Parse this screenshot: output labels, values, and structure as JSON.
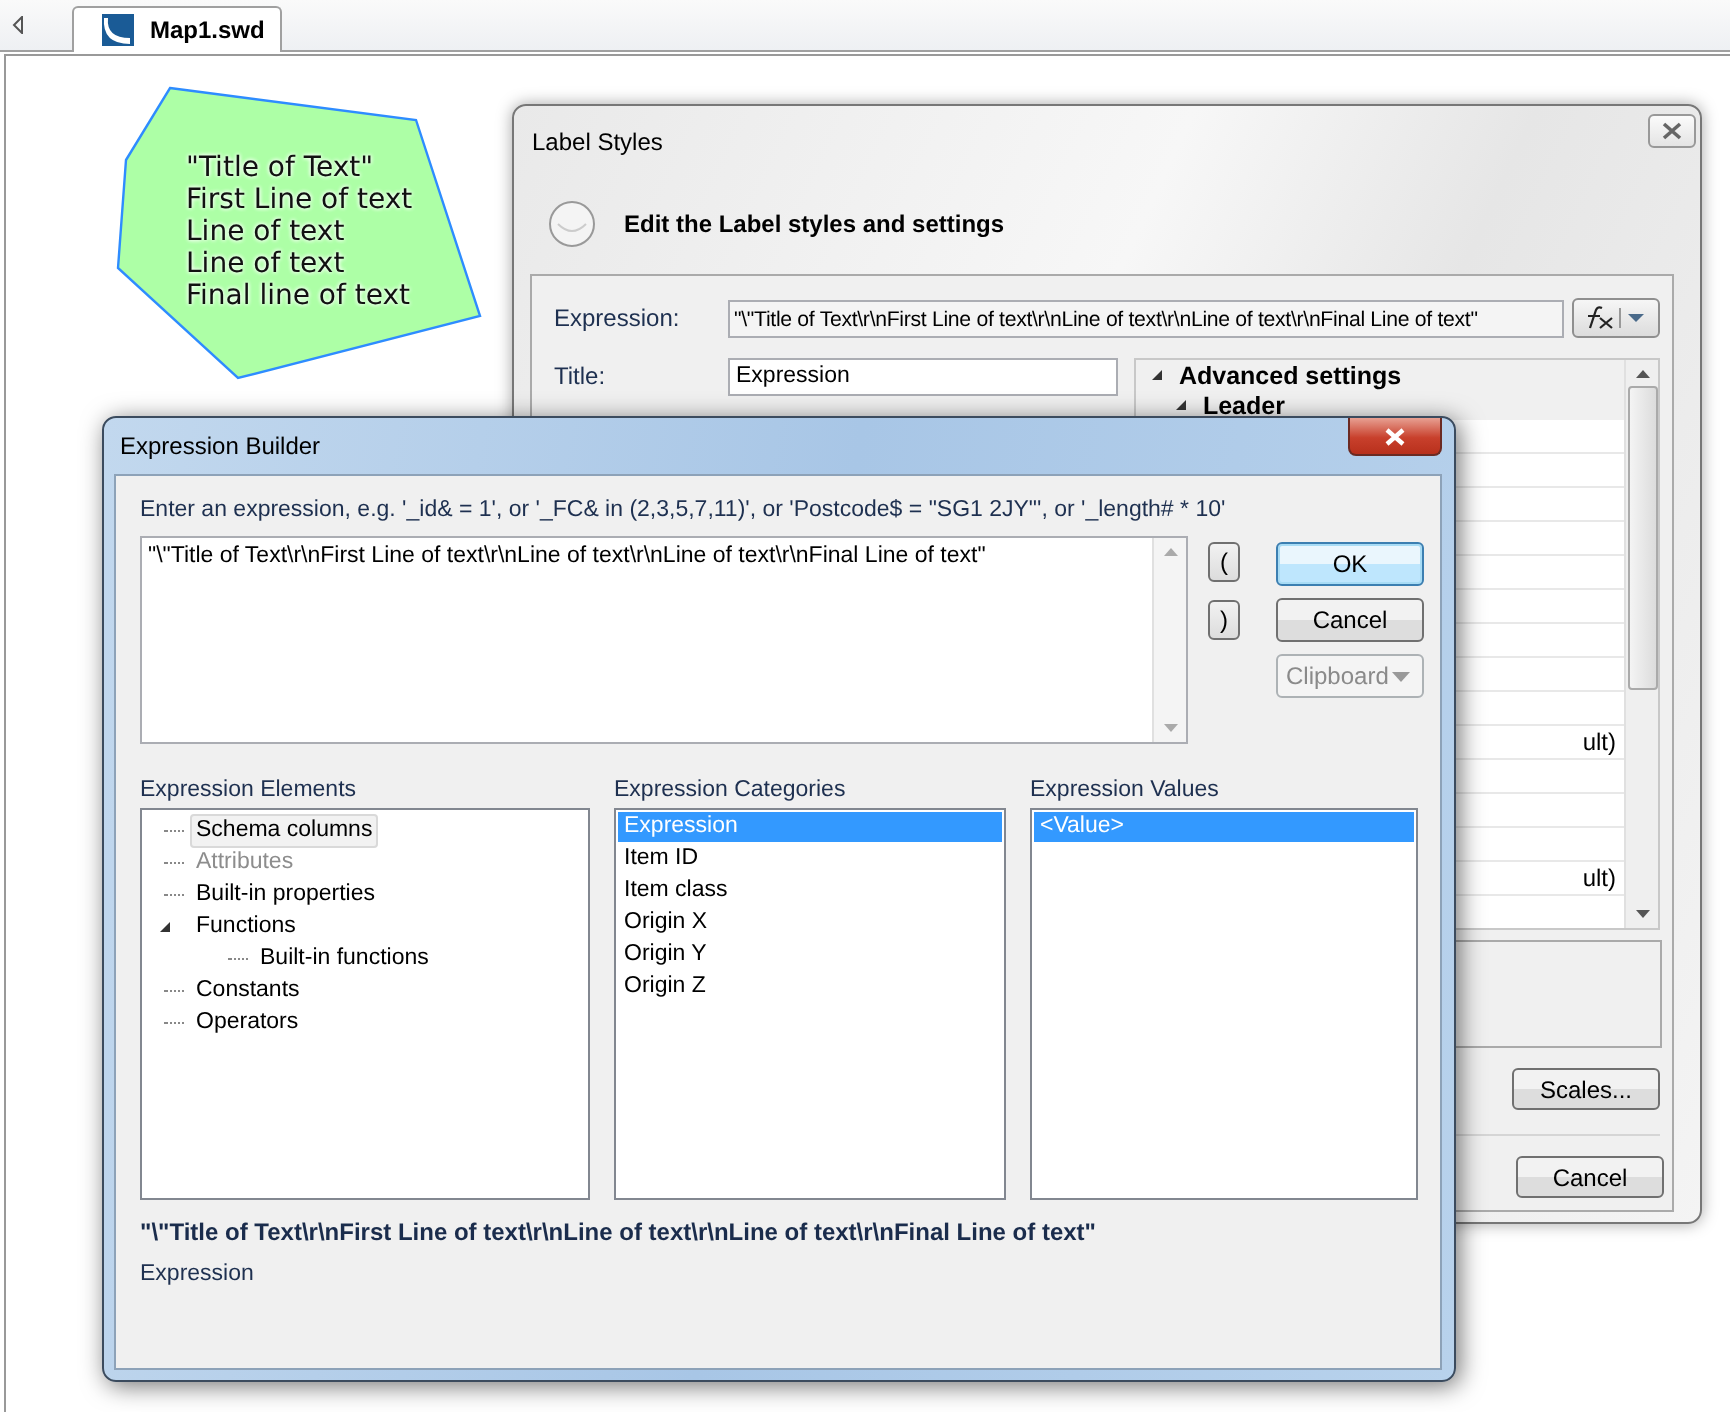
{
  "tab": {
    "label": "Map1.swd"
  },
  "map_label": {
    "lines": [
      "\"Title of Text\"",
      "First Line of text",
      "Line of text",
      "Line of text",
      "Final line of text"
    ]
  },
  "label_styles": {
    "title": "Label Styles",
    "heading": "Edit the Label styles and settings",
    "expression_label": "Expression:",
    "expression_value": "\"\\\"Title of Text\\r\\nFirst Line of text\\r\\nLine of text\\r\\nLine of text\\r\\nFinal Line of text\"",
    "title_label": "Title:",
    "title_value": "Expression",
    "tree": [
      {
        "label": "Advanced settings",
        "expanded": true
      },
      {
        "label": "Leader",
        "expanded": true
      }
    ],
    "rows": [
      "",
      "",
      "",
      "",
      "",
      "",
      "",
      "",
      "",
      "ult)",
      "",
      "",
      "",
      "ult)",
      ""
    ],
    "scales_button": "Scales...",
    "cancel_button": "Cancel"
  },
  "expression_builder": {
    "title": "Expression Builder",
    "hint": "Enter an expression, e.g. '_id& = 1', or '_FC& in (2,3,5,7,11)', or 'Postcode$ = \"SG1 2JY\"', or '_length# * 10'",
    "expression": "\"\\\"Title of Text\\r\\nFirst Line of text\\r\\nLine of text\\r\\nLine of text\\r\\nFinal Line of text\"",
    "paren_buttons": [
      "(",
      ")"
    ],
    "buttons": [
      {
        "label": "OK",
        "disabled": false,
        "kind": "button"
      },
      {
        "label": "Cancel",
        "disabled": false,
        "kind": "button"
      },
      {
        "label": "Clipboard",
        "disabled": true,
        "kind": "dropdown"
      }
    ],
    "elements_label": "Expression Elements",
    "elements": [
      {
        "label": "Schema columns",
        "selected": true,
        "disabled": false
      },
      {
        "label": "Attributes",
        "selected": false,
        "disabled": true
      },
      {
        "label": "Built-in properties",
        "selected": false,
        "disabled": false
      },
      {
        "label": "Functions",
        "selected": false,
        "disabled": false,
        "expanded": true,
        "children": [
          {
            "label": "Built-in functions",
            "selected": false,
            "disabled": false
          }
        ]
      },
      {
        "label": "Constants",
        "selected": false,
        "disabled": false
      },
      {
        "label": "Operators",
        "selected": false,
        "disabled": false
      }
    ],
    "categories_label": "Expression Categories",
    "categories": [
      {
        "label": "Expression",
        "selected": true
      },
      {
        "label": "Item ID",
        "selected": false
      },
      {
        "label": "Item class",
        "selected": false
      },
      {
        "label": "Origin X",
        "selected": false
      },
      {
        "label": "Origin Y",
        "selected": false
      },
      {
        "label": "Origin Z",
        "selected": false
      }
    ],
    "values_label": "Expression Values",
    "values": [
      {
        "label": "<Value>",
        "selected": true
      }
    ],
    "preview": "\"\\\"Title of Text\\r\\nFirst Line of text\\r\\nLine of text\\r\\nLine of text\\r\\nFinal Line of text\"",
    "preview_description": "Expression"
  }
}
